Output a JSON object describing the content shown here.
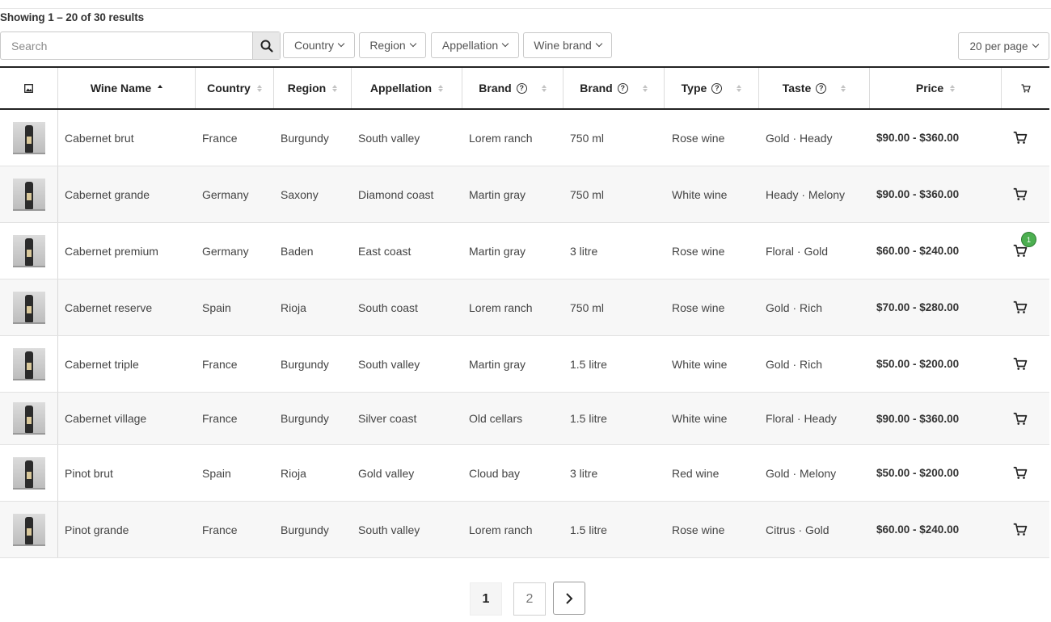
{
  "results_text": "Showing 1 – 20 of 30 results",
  "search": {
    "placeholder": "Search"
  },
  "filters": [
    "Country",
    "Region",
    "Appellation",
    "Wine brand"
  ],
  "per_page": "20 per page",
  "columns": [
    {
      "key": "image",
      "label": ""
    },
    {
      "key": "wine_name",
      "label": "Wine Name"
    },
    {
      "key": "country",
      "label": "Country"
    },
    {
      "key": "region",
      "label": "Region"
    },
    {
      "key": "appellation",
      "label": "Appellation"
    },
    {
      "key": "brand",
      "label": "Brand"
    },
    {
      "key": "size",
      "label": "Brand"
    },
    {
      "key": "type",
      "label": "Type"
    },
    {
      "key": "taste",
      "label": "Taste"
    },
    {
      "key": "price",
      "label": "Price"
    },
    {
      "key": "cart",
      "label": ""
    }
  ],
  "rows": [
    {
      "name": "Cabernet brut",
      "country": "France",
      "region": "Burgundy",
      "appellation": "South valley",
      "brand": "Lorem ranch",
      "size": "750 ml",
      "type": "Rose wine",
      "taste": "Gold · Heady",
      "price": "$90.00 - $360.00",
      "cart_count": ""
    },
    {
      "name": "Cabernet grande",
      "country": "Germany",
      "region": "Saxony",
      "appellation": "Diamond coast",
      "brand": "Martin gray",
      "size": "750 ml",
      "type": "White wine",
      "taste": "Heady · Melony",
      "price": "$90.00 - $360.00",
      "cart_count": ""
    },
    {
      "name": "Cabernet premium",
      "country": "Germany",
      "region": "Baden",
      "appellation": "East coast",
      "brand": "Martin gray",
      "size": "3 litre",
      "type": "Rose wine",
      "taste": "Floral · Gold",
      "price": "$60.00 - $240.00",
      "cart_count": "1"
    },
    {
      "name": "Cabernet reserve",
      "country": "Spain",
      "region": "Rioja",
      "appellation": "South coast",
      "brand": "Lorem ranch",
      "size": "750 ml",
      "type": "Rose wine",
      "taste": "Gold · Rich",
      "price": "$70.00 - $280.00",
      "cart_count": ""
    },
    {
      "name": "Cabernet triple",
      "country": "France",
      "region": "Burgundy",
      "appellation": "South valley",
      "brand": "Martin gray",
      "size": "1.5 litre",
      "type": "White wine",
      "taste": "Gold · Rich",
      "price": "$50.00 - $200.00",
      "cart_count": ""
    },
    {
      "name": "Cabernet village",
      "country": "France",
      "region": "Burgundy",
      "appellation": "Silver coast",
      "brand": "Old cellars",
      "size": "1.5 litre",
      "type": "White wine",
      "taste": "Floral · Heady",
      "price": "$90.00 - $360.00",
      "cart_count": ""
    },
    {
      "name": "Pinot brut",
      "country": "Spain",
      "region": "Rioja",
      "appellation": "Gold valley",
      "brand": "Cloud bay",
      "size": "3 litre",
      "type": "Red wine",
      "taste": "Gold · Melony",
      "price": "$50.00 - $200.00",
      "cart_count": ""
    },
    {
      "name": "Pinot grande",
      "country": "France",
      "region": "Burgundy",
      "appellation": "South valley",
      "brand": "Lorem ranch",
      "size": "1.5 litre",
      "type": "Rose wine",
      "taste": "Citrus · Gold",
      "price": "$60.00 - $240.00",
      "cart_count": ""
    }
  ],
  "pagination": {
    "pages": [
      "1",
      "2"
    ],
    "current": "1"
  },
  "icons": {
    "search": "search-icon",
    "image": "image-icon",
    "cart": "cart-icon",
    "help": "help-circle-icon",
    "next": "chevron-right-icon"
  },
  "colors": {
    "badge": "#4caf50",
    "header_border": "#222222",
    "row_alt": "#f7f7f7"
  }
}
